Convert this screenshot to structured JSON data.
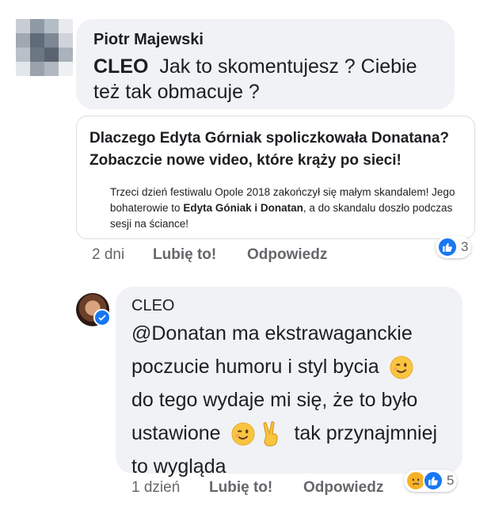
{
  "comment1": {
    "author": "Piotr Majewski",
    "mention": "CLEO",
    "text": "Jak to skomentujesz ?  Ciebie też tak obmacuje ?",
    "link_card": {
      "title": "Dlaczego Edyta Górniak spoliczkowała Donatana? Zobaczcie nowe video, które krąży po sieci!",
      "desc_part1": "Trzeci dzień festiwalu Opole 2018 zakończył się małym skandalem! Jego bohaterowie to ",
      "desc_bold": "Edyta Góniak i Donatan",
      "desc_part2": ", a do skandalu doszło podczas sesji na ściance!"
    },
    "time": "2 dni",
    "like_label": "Lubię to!",
    "reply_label": "Odpowiedz",
    "reaction_icon": "like-icon",
    "reaction_count": "3"
  },
  "comment2": {
    "author": "CLEO",
    "line1": "@Donatan ma ekstrawaganckie",
    "line2": "poczucie humoru i styl bycia",
    "line3": "do tego wydaje mi się, że to było",
    "line4a": "ustawione",
    "line4b": "tak przynajmniej",
    "line5": "to wygląda",
    "time": "1 dzień",
    "like_label": "Lubię to!",
    "reply_label": "Odpowiedz",
    "reaction_icons": [
      "sad-icon",
      "like-icon"
    ],
    "reaction_count": "5"
  },
  "colors": {
    "bubble": "#f0f2f5",
    "like_blue": "#1877f2",
    "meta_gray": "#65676b",
    "emoji_yellow": "#f7b125"
  }
}
